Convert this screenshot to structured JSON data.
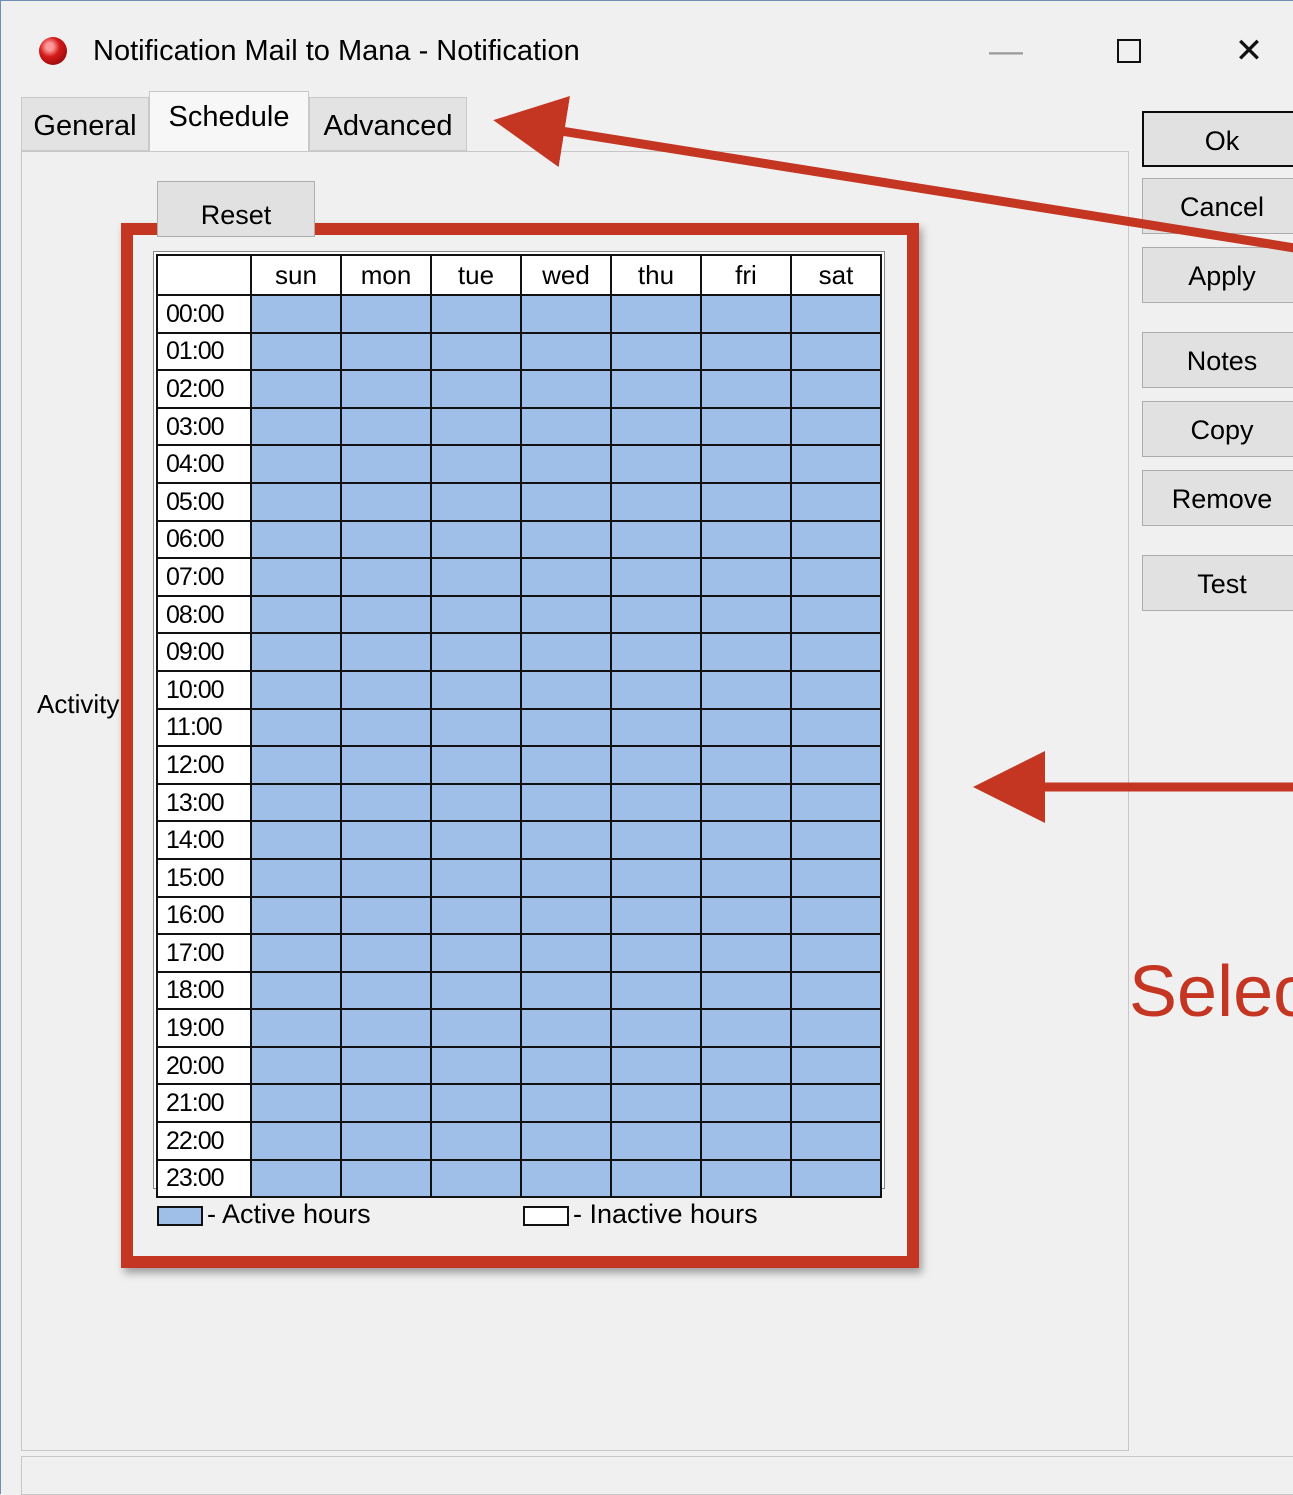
{
  "window": {
    "title": "Notification Mail to Mana - Notification",
    "controls": {
      "minimize": "—",
      "maximize": "□",
      "close": "✕"
    }
  },
  "tabs": [
    {
      "label": "General"
    },
    {
      "label": "Schedule",
      "active": true
    },
    {
      "label": "Advanced"
    }
  ],
  "schedule": {
    "reset_label": "Reset",
    "activity_label": "Activity",
    "days": [
      "sun",
      "mon",
      "tue",
      "wed",
      "thu",
      "fri",
      "sat"
    ],
    "hours": [
      "00:00",
      "01:00",
      "02:00",
      "03:00",
      "04:00",
      "05:00",
      "06:00",
      "07:00",
      "08:00",
      "09:00",
      "10:00",
      "11:00",
      "12:00",
      "13:00",
      "14:00",
      "15:00",
      "16:00",
      "17:00",
      "18:00",
      "19:00",
      "20:00",
      "21:00",
      "22:00",
      "23:00"
    ],
    "all_active": true,
    "legend_active": "- Active hours",
    "legend_inactive": "- Inactive hours"
  },
  "side_buttons": {
    "ok": "Ok",
    "cancel": "Cancel",
    "apply": "Apply",
    "notes": "Notes",
    "copy": "Copy",
    "remove": "Remove",
    "test": "Test"
  },
  "annotation": {
    "text": "Selec"
  },
  "colors": {
    "active_cell": "#9fbfe8",
    "highlight": "#c43522",
    "window_bg": "#f0f0f0"
  }
}
